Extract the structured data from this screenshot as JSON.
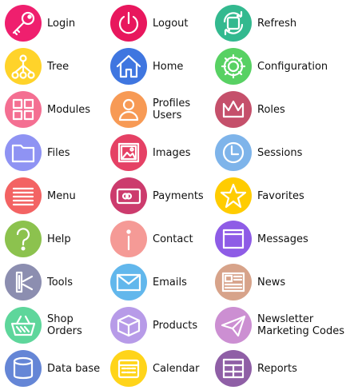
{
  "items": [
    {
      "label": [
        "Login"
      ],
      "icon": "key-icon",
      "color": "#ef1f6e"
    },
    {
      "label": [
        "Logout"
      ],
      "icon": "power-icon",
      "color": "#e8175d"
    },
    {
      "label": [
        "Refresh"
      ],
      "icon": "refresh-icon",
      "color": "#33b98f"
    },
    {
      "label": [
        "Tree"
      ],
      "icon": "tree-icon",
      "color": "#ffd32a"
    },
    {
      "label": [
        "Home"
      ],
      "icon": "home-icon",
      "color": "#3f76e0"
    },
    {
      "label": [
        "Configuration"
      ],
      "icon": "gear-icon",
      "color": "#58d163"
    },
    {
      "label": [
        "Modules"
      ],
      "icon": "modules-icon",
      "color": "#f46f92"
    },
    {
      "label": [
        "Profiles",
        "Users"
      ],
      "icon": "user-icon",
      "color": "#f79a55"
    },
    {
      "label": [
        "Roles"
      ],
      "icon": "crown-icon",
      "color": "#c5506b"
    },
    {
      "label": [
        "Files"
      ],
      "icon": "folder-icon",
      "color": "#8f93f3"
    },
    {
      "label": [
        "Images"
      ],
      "icon": "image-icon",
      "color": "#e54165"
    },
    {
      "label": [
        "Sessions"
      ],
      "icon": "clock-icon",
      "color": "#7eb4ea"
    },
    {
      "label": [
        "Menu"
      ],
      "icon": "menu-icon",
      "color": "#f36363"
    },
    {
      "label": [
        "Payments"
      ],
      "icon": "credit-card-icon",
      "color": "#cc3b6d"
    },
    {
      "label": [
        "Favorites"
      ],
      "icon": "star-icon",
      "color": "#ffcc00"
    },
    {
      "label": [
        "Help"
      ],
      "icon": "question-icon",
      "color": "#8cc24e"
    },
    {
      "label": [
        "Contact"
      ],
      "icon": "info-icon",
      "color": "#f59a96"
    },
    {
      "label": [
        "Messages"
      ],
      "icon": "window-icon",
      "color": "#8e5ce6"
    },
    {
      "label": [
        "Tools"
      ],
      "icon": "tools-icon",
      "color": "#8c8eb0"
    },
    {
      "label": [
        "Emails"
      ],
      "icon": "envelope-icon",
      "color": "#62b7ec"
    },
    {
      "label": [
        "News"
      ],
      "icon": "news-icon",
      "color": "#d7a38a"
    },
    {
      "label": [
        "Shop",
        "Orders"
      ],
      "icon": "basket-icon",
      "color": "#5ed69b"
    },
    {
      "label": [
        "Products"
      ],
      "icon": "box-icon",
      "color": "#b79be8"
    },
    {
      "label": [
        "Newsletter",
        "Marketing Codes"
      ],
      "icon": "paper-plane-icon",
      "color": "#cc8fd2"
    },
    {
      "label": [
        "Data base"
      ],
      "icon": "database-icon",
      "color": "#6586d6"
    },
    {
      "label": [
        "Calendar"
      ],
      "icon": "calendar-icon",
      "color": "#ffd41a"
    },
    {
      "label": [
        "Reports"
      ],
      "icon": "reports-icon",
      "color": "#8f5fa6"
    }
  ]
}
